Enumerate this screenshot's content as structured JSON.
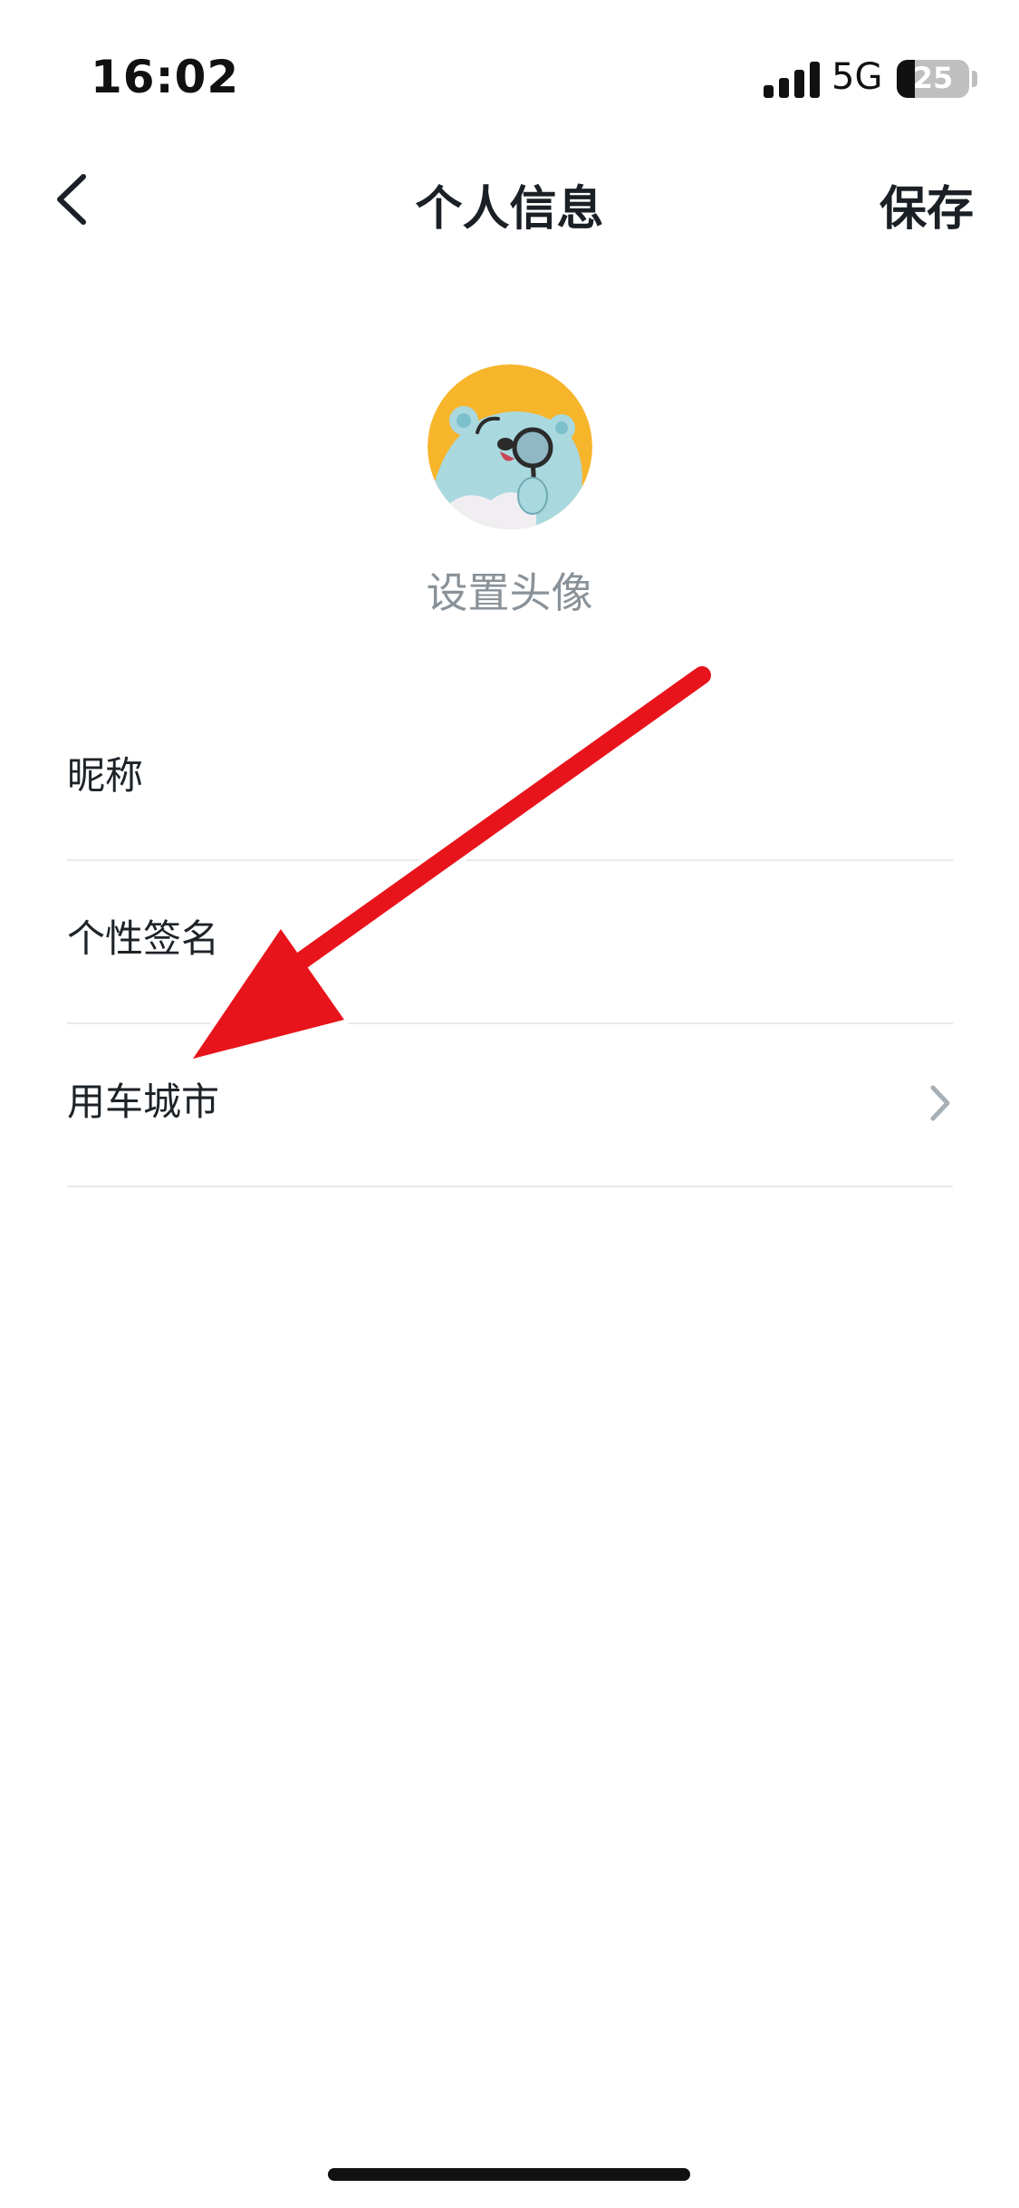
{
  "status_bar": {
    "time": "16:02",
    "network": "5G",
    "battery_level": "25",
    "battery_fraction": 0.25
  },
  "nav": {
    "back_icon": "chevron-left-icon",
    "title": "个人信息",
    "save_label": "保存"
  },
  "avatar": {
    "label": "设置头像",
    "colors": {
      "background": "#F7B52B",
      "bear": "#A9D8DF"
    }
  },
  "form": {
    "rows": [
      {
        "label": "昵称",
        "value": ""
      },
      {
        "label": "个性签名",
        "value": ""
      },
      {
        "label": "用车城市",
        "value": "",
        "chevron": "chevron-right-icon"
      }
    ]
  },
  "annotation": {
    "color": "#E8141B"
  }
}
